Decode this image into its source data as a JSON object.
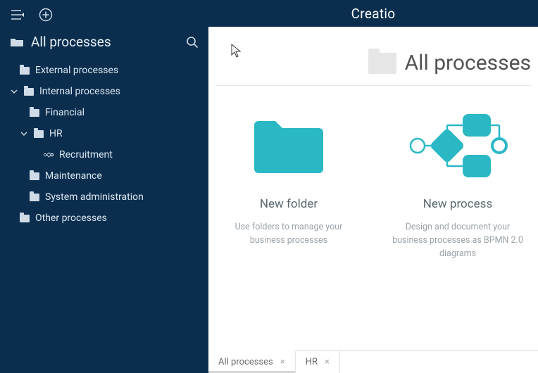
{
  "brand": "Creatio",
  "sidebar": {
    "title": "All processes",
    "items": [
      {
        "label": "External processes",
        "type": "folder",
        "indent": 1,
        "expanded": null
      },
      {
        "label": "Internal processes",
        "type": "folder",
        "indent": 1,
        "expanded": true
      },
      {
        "label": "Financial",
        "type": "folder",
        "indent": 2,
        "expanded": null
      },
      {
        "label": "HR",
        "type": "folder",
        "indent": 2,
        "expanded": true
      },
      {
        "label": "Recruitment",
        "type": "process",
        "indent": 3,
        "expanded": null
      },
      {
        "label": "Maintenance",
        "type": "folder",
        "indent": 2,
        "expanded": null
      },
      {
        "label": "System administration",
        "type": "folder",
        "indent": 2,
        "expanded": null
      },
      {
        "label": "Other processes",
        "type": "folder",
        "indent": 1,
        "expanded": null
      }
    ]
  },
  "main": {
    "title": "All processes",
    "cards": {
      "folder": {
        "title": "New folder",
        "desc": "Use folders to manage your business processes"
      },
      "process": {
        "title": "New process",
        "desc": "Design and document your business processes as BPMN 2.0 diagrams"
      }
    }
  },
  "tabs": [
    {
      "label": "All processes"
    },
    {
      "label": "HR"
    }
  ],
  "colors": {
    "accent": "#2ab8c5",
    "sidebar": "#0b2e4f"
  }
}
